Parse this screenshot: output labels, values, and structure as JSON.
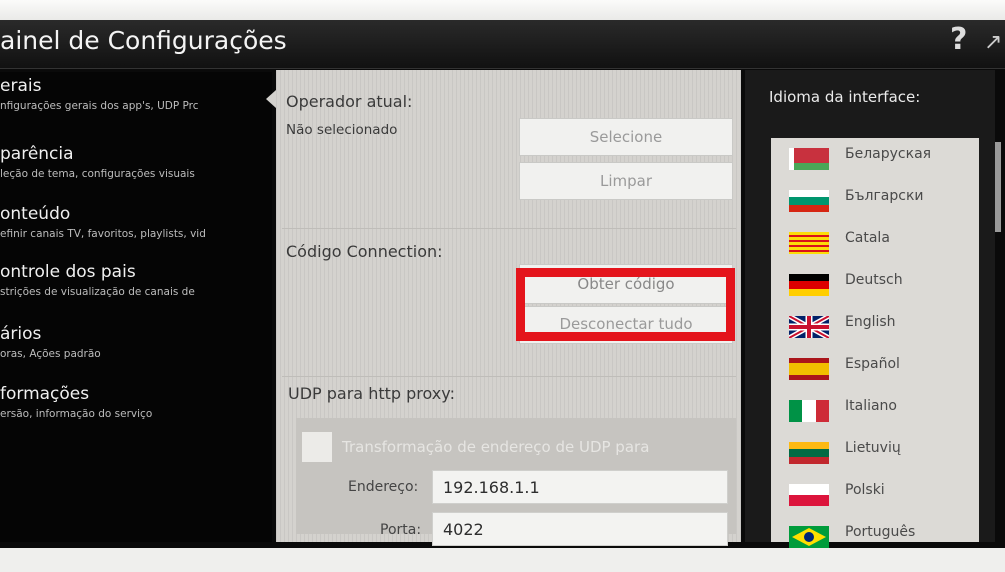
{
  "window": {
    "title": "ainel de Configurações"
  },
  "icons": {
    "help": "?",
    "arrow": "↗"
  },
  "sidebar": {
    "items": [
      {
        "title": "erais",
        "subtitle": "nfigurações gerais dos app's, UDP Prc"
      },
      {
        "title": "parência",
        "subtitle": "leção de tema, configurações visuais"
      },
      {
        "title": "onteúdo",
        "subtitle": "efinir canais TV, favoritos, playlists, vid"
      },
      {
        "title": "ontrole dos pais",
        "subtitle": "strições de visualização de canais de"
      },
      {
        "title": "ários",
        "subtitle": "oras, Ações padrão"
      },
      {
        "title": "formações",
        "subtitle": "ersão, informação do serviço"
      }
    ]
  },
  "operator": {
    "heading": "Operador atual:",
    "value": "Não selecionado",
    "select_label": "Selecione",
    "clear_label": "Limpar"
  },
  "connection": {
    "heading": "Código Connection:",
    "get_code_label": "Obter código",
    "disconnect_label": "Desconectar tudo"
  },
  "udp": {
    "heading": "UDP para http proxy:",
    "transform_label": "Transformação de endereço de UDP para",
    "address_label": "Endereço:",
    "address_value": "192.168.1.1",
    "port_label": "Porta:",
    "port_value": "4022"
  },
  "language": {
    "heading": "Idioma da interface:",
    "items": [
      {
        "name": "Беларуская",
        "flag": "belarus"
      },
      {
        "name": "Български",
        "flag": "bulgaria"
      },
      {
        "name": "Catala",
        "flag": "catalonia"
      },
      {
        "name": "Deutsch",
        "flag": "germany"
      },
      {
        "name": "English",
        "flag": "uk"
      },
      {
        "name": "Español",
        "flag": "spain"
      },
      {
        "name": "Italiano",
        "flag": "italy"
      },
      {
        "name": "Lietuvių",
        "flag": "lithuania"
      },
      {
        "name": "Polski",
        "flag": "poland"
      },
      {
        "name": "Português",
        "flag": "brazil"
      }
    ]
  },
  "colors": {
    "highlight": "#e4141b",
    "panel": "#d4d2ce",
    "background": "#0a0a0a"
  }
}
